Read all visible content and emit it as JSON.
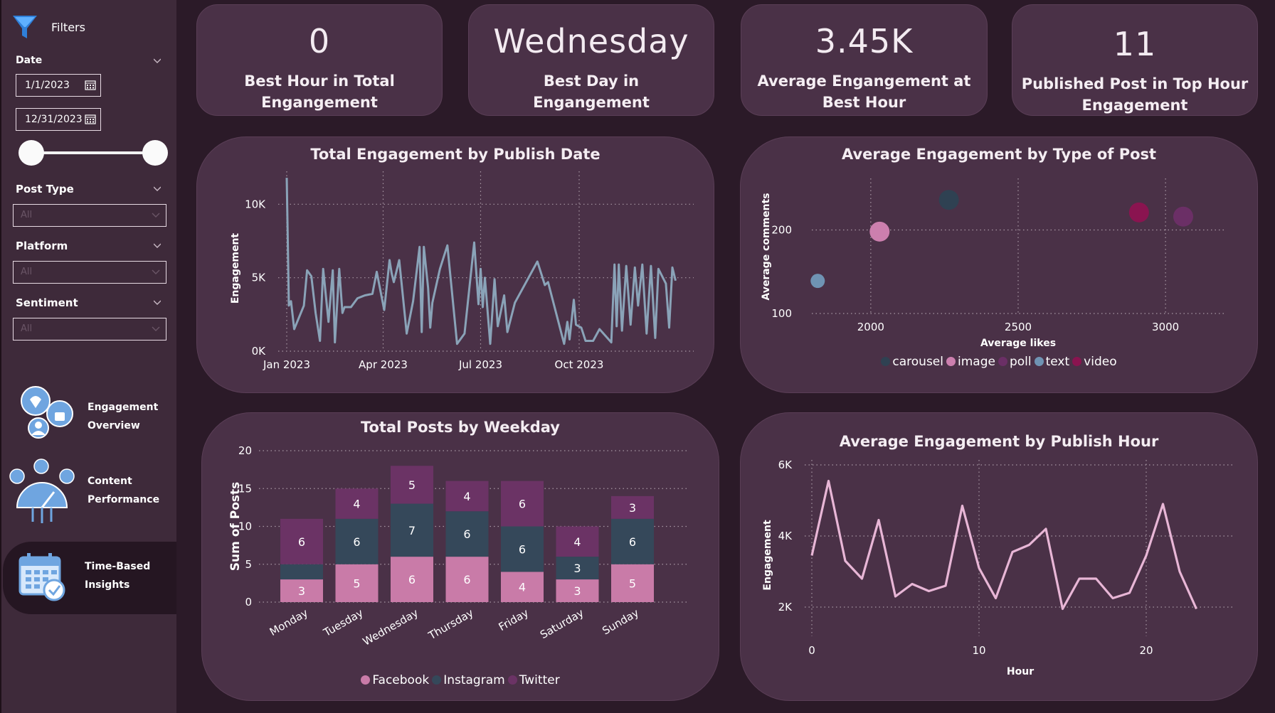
{
  "sidebar": {
    "filters_label": "Filters",
    "date_label": "Date",
    "date_start": "1/1/2023",
    "date_end": "12/31/2023",
    "post_type_label": "Post Type",
    "post_type_value": "All",
    "platform_label": "Platform",
    "platform_value": "All",
    "sentiment_label": "Sentiment",
    "sentiment_value": "All",
    "nav": [
      {
        "line1": "Engagement",
        "line2": "Overview"
      },
      {
        "line1": "Content",
        "line2": "Performance"
      },
      {
        "line1": "Time-Based",
        "line2": "Insights"
      }
    ]
  },
  "kpis": [
    {
      "value": "0",
      "line1": "Best Hour in Total",
      "line2": "Engangement"
    },
    {
      "value": "Wednesday",
      "line1": "Best Day in",
      "line2": "Engangement"
    },
    {
      "value": "3.45K",
      "line1": "Average Engangement at",
      "line2": "Best Hour"
    },
    {
      "value": "11",
      "line1": "Published Post in Top Hour",
      "line2": "Engagement"
    }
  ],
  "colors": {
    "line_main": "#8aa3b8",
    "line_hour": "#e8b6d6",
    "facebook": "#c97ba8",
    "instagram": "#35485a",
    "twitter": "#6b3365",
    "carousel": "#2f4152",
    "image": "#cc7fae",
    "poll": "#6b2f66",
    "text": "#6f93b3",
    "video": "#8a1450"
  },
  "chart_data": [
    {
      "type": "line",
      "title": "Total Engagement by Publish Date",
      "ylabel": "Engagement",
      "xlabel": "",
      "ylim": [
        0,
        12000
      ],
      "y_ticks": [
        "0K",
        "5K",
        "10K"
      ],
      "x_ticks": [
        "Jan 2023",
        "Apr 2023",
        "Jul 2023",
        "Oct 2023"
      ],
      "x_tick_dates": [
        "2023-01-01",
        "2023-04-01",
        "2023-07-01",
        "2023-10-01"
      ],
      "x_range": [
        "2023-01-01",
        "2023-12-31"
      ],
      "points": [
        [
          "2023-01-01",
          11800
        ],
        [
          "2023-01-03",
          3100
        ],
        [
          "2023-01-05",
          3400
        ],
        [
          "2023-01-08",
          1500
        ],
        [
          "2023-01-17",
          3100
        ],
        [
          "2023-01-20",
          5500
        ],
        [
          "2023-01-24",
          5100
        ],
        [
          "2023-01-28",
          2600
        ],
        [
          "2023-02-01",
          700
        ],
        [
          "2023-02-04",
          5600
        ],
        [
          "2023-02-09",
          2000
        ],
        [
          "2023-02-13",
          5500
        ],
        [
          "2023-02-15",
          600
        ],
        [
          "2023-02-19",
          5600
        ],
        [
          "2023-02-22",
          2600
        ],
        [
          "2023-02-24",
          3000
        ],
        [
          "2023-03-02",
          3000
        ],
        [
          "2023-03-08",
          3600
        ],
        [
          "2023-03-15",
          3800
        ],
        [
          "2023-03-22",
          3900
        ],
        [
          "2023-03-26",
          5400
        ],
        [
          "2023-04-02",
          2800
        ],
        [
          "2023-04-07",
          6200
        ],
        [
          "2023-04-09",
          5300
        ],
        [
          "2023-04-11",
          4700
        ],
        [
          "2023-04-16",
          6200
        ],
        [
          "2023-04-23",
          1200
        ],
        [
          "2023-04-29",
          3400
        ],
        [
          "2023-05-05",
          7100
        ],
        [
          "2023-05-07",
          1300
        ],
        [
          "2023-05-09",
          7100
        ],
        [
          "2023-05-13",
          4300
        ],
        [
          "2023-05-15",
          1600
        ],
        [
          "2023-05-17",
          3300
        ],
        [
          "2023-05-24",
          5600
        ],
        [
          "2023-05-31",
          7200
        ],
        [
          "2023-06-09",
          500
        ],
        [
          "2023-06-16",
          1200
        ],
        [
          "2023-06-25",
          7400
        ],
        [
          "2023-06-29",
          3200
        ],
        [
          "2023-07-01",
          5600
        ],
        [
          "2023-07-03",
          3000
        ],
        [
          "2023-07-05",
          5000
        ],
        [
          "2023-07-10",
          500
        ],
        [
          "2023-07-14",
          4900
        ],
        [
          "2023-07-17",
          1700
        ],
        [
          "2023-07-23",
          3800
        ],
        [
          "2023-07-26",
          1300
        ],
        [
          "2023-08-02",
          3300
        ],
        [
          "2023-08-23",
          6100
        ],
        [
          "2023-08-30",
          4500
        ],
        [
          "2023-09-02",
          4700
        ],
        [
          "2023-09-17",
          500
        ],
        [
          "2023-09-20",
          2000
        ],
        [
          "2023-09-22",
          800
        ],
        [
          "2023-09-26",
          3500
        ],
        [
          "2023-09-28",
          1800
        ],
        [
          "2023-10-03",
          1600
        ],
        [
          "2023-10-07",
          700
        ],
        [
          "2023-10-14",
          700
        ],
        [
          "2023-10-20",
          1500
        ],
        [
          "2023-10-31",
          600
        ],
        [
          "2023-11-03",
          5900
        ],
        [
          "2023-11-05",
          1700
        ],
        [
          "2023-11-07",
          5900
        ],
        [
          "2023-11-10",
          1400
        ],
        [
          "2023-11-14",
          5800
        ],
        [
          "2023-11-18",
          1800
        ],
        [
          "2023-11-22",
          5700
        ],
        [
          "2023-11-25",
          3100
        ],
        [
          "2023-11-29",
          5900
        ],
        [
          "2023-12-03",
          1200
        ],
        [
          "2023-12-07",
          5800
        ],
        [
          "2023-12-11",
          900
        ],
        [
          "2023-12-14",
          5600
        ],
        [
          "2023-12-21",
          4600
        ],
        [
          "2023-12-24",
          1600
        ],
        [
          "2023-12-27",
          5700
        ],
        [
          "2023-12-30",
          4800
        ]
      ]
    },
    {
      "type": "scatter",
      "title": "Average Engagement by Type of Post",
      "xlabel": "Average likes",
      "ylabel": "Average comments",
      "xlim": [
        1800,
        3200
      ],
      "ylim": [
        100,
        260
      ],
      "x_ticks": [
        2000,
        2500,
        3000
      ],
      "y_ticks": [
        100,
        200
      ],
      "legend": [
        "carousel",
        "image",
        "poll",
        "text",
        "video"
      ],
      "points": [
        {
          "name": "text",
          "x": 1820,
          "y": 139
        },
        {
          "name": "image",
          "x": 2030,
          "y": 198
        },
        {
          "name": "carousel",
          "x": 2265,
          "y": 236
        },
        {
          "name": "video",
          "x": 2910,
          "y": 221
        },
        {
          "name": "poll",
          "x": 3060,
          "y": 216
        }
      ]
    },
    {
      "type": "bar",
      "title": "Total Posts by Weekday",
      "ylabel": "Sum of Posts",
      "xlabel": "",
      "ylim": [
        0,
        20
      ],
      "y_ticks": [
        0,
        5,
        10,
        15,
        20
      ],
      "categories": [
        "Monday",
        "Tuesday",
        "Wednesday",
        "Thursday",
        "Friday",
        "Saturday",
        "Sunday"
      ],
      "series": [
        {
          "name": "Facebook",
          "values": [
            3,
            5,
            6,
            6,
            4,
            3,
            5
          ]
        },
        {
          "name": "Instagram",
          "values": [
            2,
            6,
            7,
            6,
            6,
            3,
            6
          ]
        },
        {
          "name": "Twitter",
          "values": [
            6,
            4,
            5,
            4,
            6,
            4,
            3
          ]
        }
      ],
      "hidden_labels": [
        [
          false,
          true,
          false
        ]
      ]
    },
    {
      "type": "line",
      "title": "Average Engagement by Publish Hour",
      "xlabel": "Hour",
      "ylabel": "Engagement",
      "xlim": [
        0,
        23
      ],
      "ylim": [
        1500,
        6000
      ],
      "x_ticks": [
        0,
        10,
        20
      ],
      "y_ticks": [
        "2K",
        "4K",
        "6K"
      ],
      "y_tick_values": [
        2000,
        4000,
        6000
      ],
      "x": [
        0,
        1,
        2,
        3,
        4,
        5,
        6,
        7,
        8,
        9,
        10,
        11,
        12,
        13,
        14,
        15,
        16,
        17,
        18,
        19,
        20,
        21,
        22,
        23
      ],
      "values": [
        3450,
        5550,
        3300,
        2800,
        4450,
        2300,
        2650,
        2450,
        2600,
        4850,
        3100,
        2250,
        3550,
        3750,
        4200,
        1950,
        2800,
        2800,
        2250,
        2400,
        3450,
        4900,
        3000,
        1950
      ]
    }
  ]
}
